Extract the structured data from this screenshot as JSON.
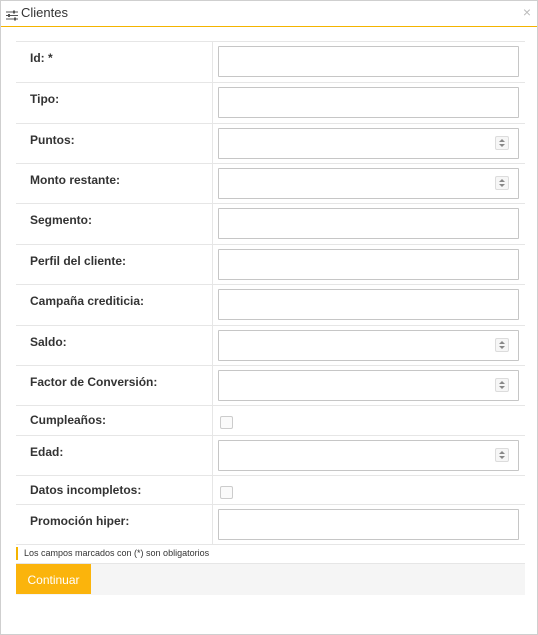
{
  "dialog": {
    "title": "Clientes",
    "close_symbol": "×",
    "title_icon": "sliders-icon",
    "accent_color": "#f4b400"
  },
  "fields": [
    {
      "label": "Id: *",
      "type": "text",
      "value": ""
    },
    {
      "label": "Tipo:",
      "type": "text",
      "value": ""
    },
    {
      "label": "Puntos:",
      "type": "number",
      "value": ""
    },
    {
      "label": "Monto restante:",
      "type": "number",
      "value": ""
    },
    {
      "label": "Segmento:",
      "type": "text",
      "value": ""
    },
    {
      "label": "Perfil del cliente:",
      "type": "text",
      "value": ""
    },
    {
      "label": "Campaña crediticia:",
      "type": "text",
      "value": ""
    },
    {
      "label": "Saldo:",
      "type": "number",
      "value": ""
    },
    {
      "label": "Factor de Conversión:",
      "type": "number",
      "value": ""
    },
    {
      "label": "Cumpleaños:",
      "type": "checkbox",
      "checked": false
    },
    {
      "label": "Edad:",
      "type": "number",
      "value": ""
    },
    {
      "label": "Datos incompletos:",
      "type": "checkbox",
      "checked": false
    },
    {
      "label": "Promoción hiper:",
      "type": "text",
      "value": ""
    }
  ],
  "footer": {
    "required_note": "Los campos marcados con (*) son obligatorios",
    "continue_label": "Continuar",
    "button_color": "#fbb40c"
  }
}
